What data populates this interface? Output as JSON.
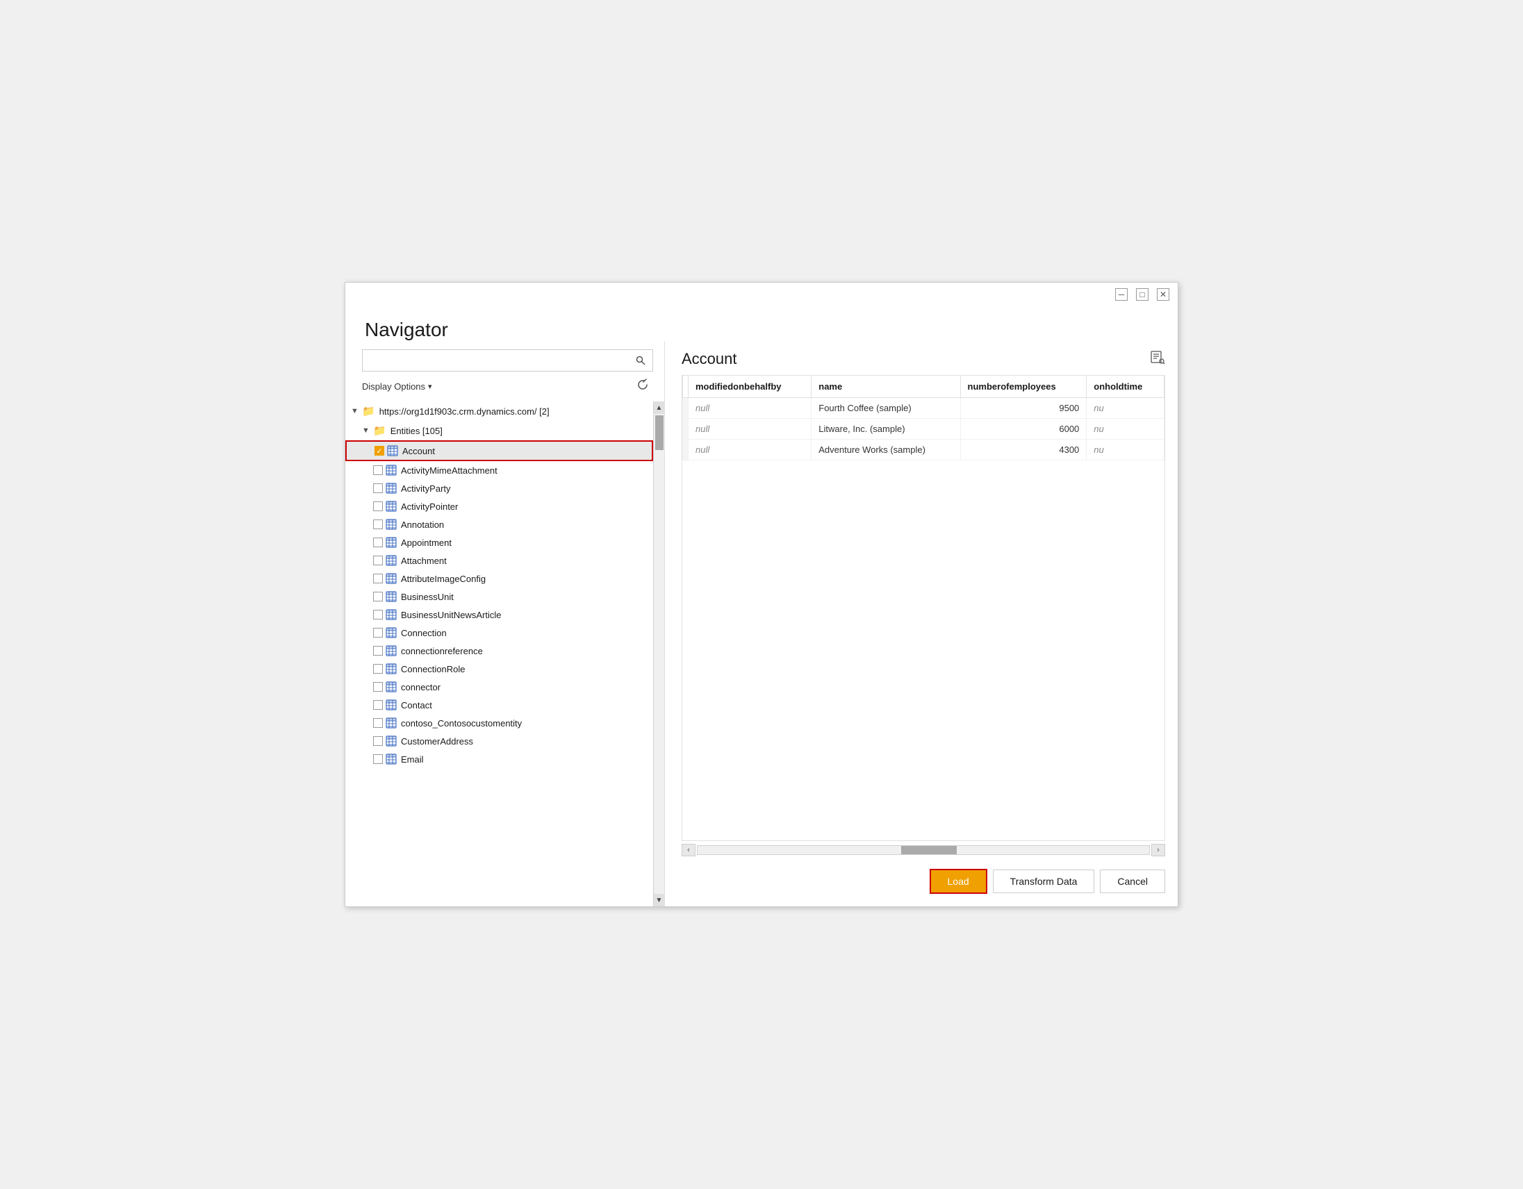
{
  "window": {
    "title": "Navigator",
    "minimize_label": "─",
    "maximize_label": "□",
    "close_label": "✕"
  },
  "search": {
    "placeholder": "",
    "value": ""
  },
  "display_options": {
    "label": "Display Options",
    "arrow": "▾"
  },
  "tree": {
    "root": {
      "label": "https://org1d1f903c.crm.dynamics.com/ [2]",
      "arrow": "◀"
    },
    "entities_node": {
      "label": "Entities [105]",
      "arrow": "◀"
    },
    "items": [
      {
        "name": "Account",
        "checked": true
      },
      {
        "name": "ActivityMimeAttachment",
        "checked": false
      },
      {
        "name": "ActivityParty",
        "checked": false
      },
      {
        "name": "ActivityPointer",
        "checked": false
      },
      {
        "name": "Annotation",
        "checked": false
      },
      {
        "name": "Appointment",
        "checked": false
      },
      {
        "name": "Attachment",
        "checked": false
      },
      {
        "name": "AttributeImageConfig",
        "checked": false
      },
      {
        "name": "BusinessUnit",
        "checked": false
      },
      {
        "name": "BusinessUnitNewsArticle",
        "checked": false
      },
      {
        "name": "Connection",
        "checked": false
      },
      {
        "name": "connectionreference",
        "checked": false
      },
      {
        "name": "ConnectionRole",
        "checked": false
      },
      {
        "name": "connector",
        "checked": false
      },
      {
        "name": "Contact",
        "checked": false
      },
      {
        "name": "contoso_Contosocustomentity",
        "checked": false
      },
      {
        "name": "CustomerAddress",
        "checked": false
      },
      {
        "name": "Email",
        "checked": false
      }
    ]
  },
  "preview": {
    "title": "Account",
    "columns": [
      {
        "key": "modifiedonbehalfby",
        "label": "modifiedonbehalfby"
      },
      {
        "key": "name",
        "label": "name"
      },
      {
        "key": "numberofemployees",
        "label": "numberofemployees"
      },
      {
        "key": "onholdtime",
        "label": "onholdtime"
      }
    ],
    "rows": [
      {
        "modifiedonbehalfby": "null",
        "name": "Fourth Coffee (sample)",
        "numberofemployees": "9500",
        "onholdtime": "nu"
      },
      {
        "modifiedonbehalfby": "null",
        "name": "Litware, Inc. (sample)",
        "numberofemployees": "6000",
        "onholdtime": "nu"
      },
      {
        "modifiedonbehalfby": "null",
        "name": "Adventure Works (sample)",
        "numberofemployees": "4300",
        "onholdtime": "nu"
      }
    ]
  },
  "buttons": {
    "load": "Load",
    "transform_data": "Transform Data",
    "cancel": "Cancel"
  }
}
